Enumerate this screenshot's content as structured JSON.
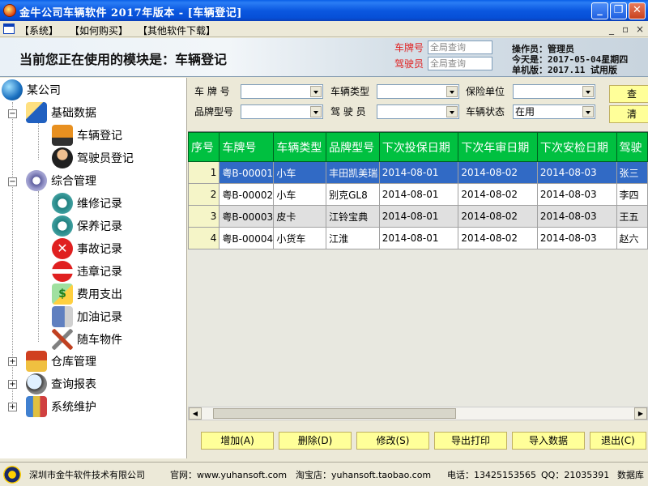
{
  "window": {
    "title": "金牛公司车辆软件 2017年版本 - [车辆登记]"
  },
  "menu": {
    "items": [
      "【系统】",
      "【如何购买】",
      "【其他软件下载】"
    ],
    "mdi_controls": [
      "_",
      "▫",
      "×"
    ]
  },
  "banner": {
    "module_label": "当前您正在使用的模块是：车辆登记",
    "plate_label": "车牌号",
    "driver_label": "驾驶员",
    "plate_placeholder": "全局查询",
    "driver_placeholder": "全局查询",
    "operator": "操作员：管理员",
    "today": "今天是：2017-05-04星期四",
    "version": "单机版：2017.11 试用版"
  },
  "tree": {
    "root": "某公司",
    "groups": [
      {
        "label": "基础数据",
        "children": [
          "车辆登记",
          "驾驶员登记"
        ]
      },
      {
        "label": "综合管理",
        "children": [
          "维修记录",
          "保养记录",
          "事故记录",
          "违章记录",
          "费用支出",
          "加油记录",
          "随车物件"
        ]
      },
      {
        "label": "仓库管理"
      },
      {
        "label": "查询报表"
      },
      {
        "label": "系统维护"
      }
    ]
  },
  "filters": {
    "plate": "车 牌 号",
    "vehicle_type": "车辆类型",
    "insurer": "保险单位",
    "brand_model": "品牌型号",
    "driver": "驾 驶 员",
    "vehicle_status": "车辆状态",
    "status_value": "在用",
    "query_button": "查",
    "clear_button": "清"
  },
  "grid": {
    "headers": [
      "序号",
      "车牌号",
      "车辆类型",
      "品牌型号",
      "下次投保日期",
      "下次年审日期",
      "下次安检日期",
      "驾驶"
    ],
    "rows": [
      [
        "1",
        "粤B-00001",
        "小车",
        "丰田凯美瑞",
        "2014-08-01",
        "2014-08-02",
        "2014-08-03",
        "张三"
      ],
      [
        "2",
        "粤B-00002",
        "小车",
        "别克GL8",
        "2014-08-01",
        "2014-08-02",
        "2014-08-03",
        "李四"
      ],
      [
        "3",
        "粤B-00003",
        "皮卡",
        "江铃宝典",
        "2014-08-01",
        "2014-08-02",
        "2014-08-03",
        "王五"
      ],
      [
        "4",
        "粤B-00004",
        "小货车",
        "江淮",
        "2014-08-01",
        "2014-08-02",
        "2014-08-03",
        "赵六"
      ]
    ]
  },
  "actions": [
    "增加(A)",
    "删除(D)",
    "修改(S)",
    "导出打印",
    "导入数据",
    "退出(C)"
  ],
  "statusbar": {
    "company": "深圳市金牛软件技术有限公司",
    "website": "官网：www.yuhansoft.com",
    "taobao": "淘宝店：yuhansoft.taobao.com",
    "phone": "电话：13425153565",
    "qq": "QQ：21035391",
    "db": "数据库"
  },
  "colors": {
    "grid_header": "#00c040",
    "selected_row": "#316ac5",
    "button_yellow": "#ffff99",
    "titlebar": "#0b58e0"
  }
}
